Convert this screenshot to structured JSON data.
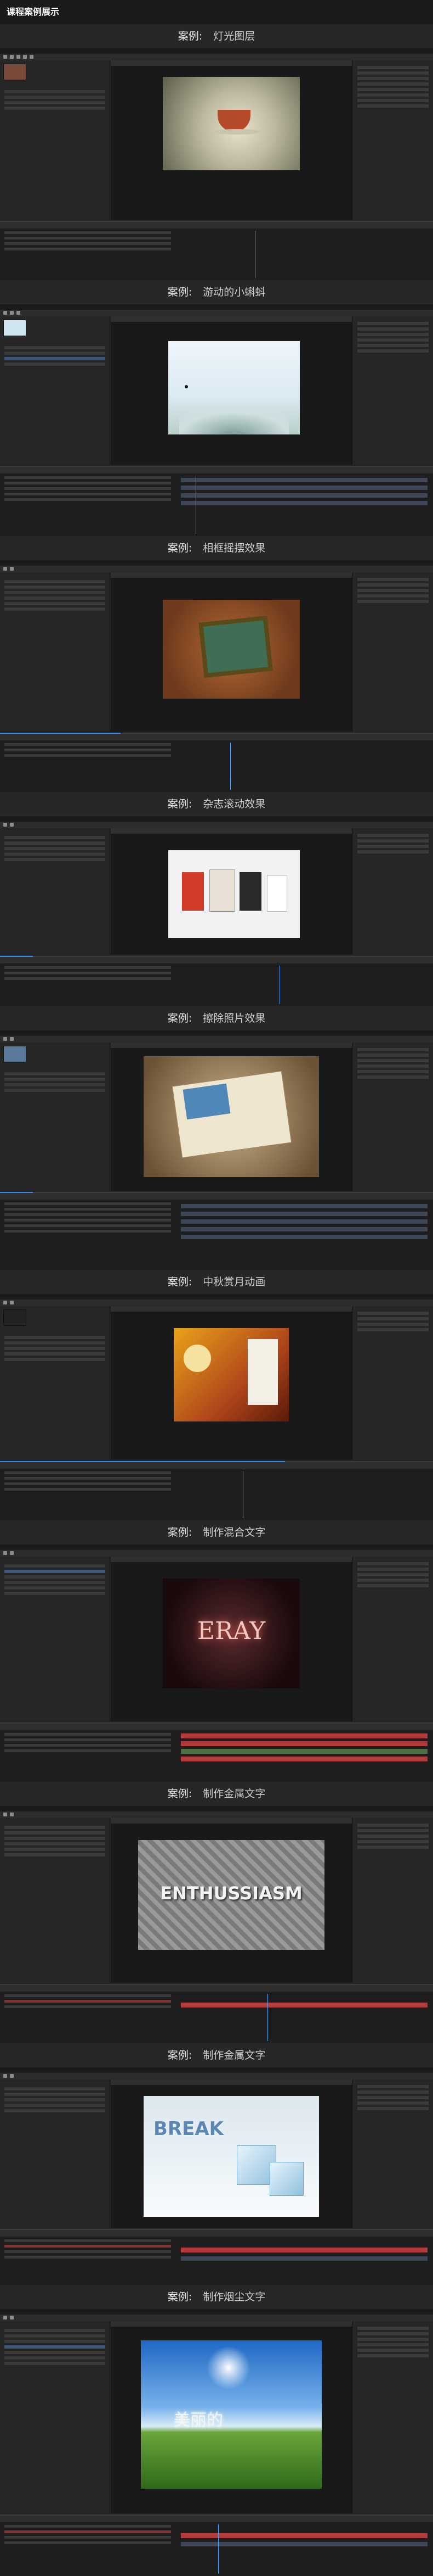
{
  "page": {
    "title": "课程案例展示"
  },
  "label_prefix": "案例:",
  "cases": [
    {
      "name": "灯光图层"
    },
    {
      "name": "游动的小蝌蚪"
    },
    {
      "name": "相框摇摆效果"
    },
    {
      "name": "杂志滚动效果"
    },
    {
      "name": "擦除照片效果"
    },
    {
      "name": "中秋赏月动画"
    },
    {
      "name": "制作混合文字",
      "comp_text": "ERAY"
    },
    {
      "name": "制作金属文字",
      "comp_text": "ENTHUSSIASM"
    },
    {
      "name": "制作金属文字",
      "comp_text": "BREAK"
    },
    {
      "name": "制作烟尘文字",
      "comp_text": "美丽的"
    }
  ],
  "colors": {
    "accent": "#2d8cf0",
    "panel": "#262626",
    "viewer": "#191919"
  }
}
